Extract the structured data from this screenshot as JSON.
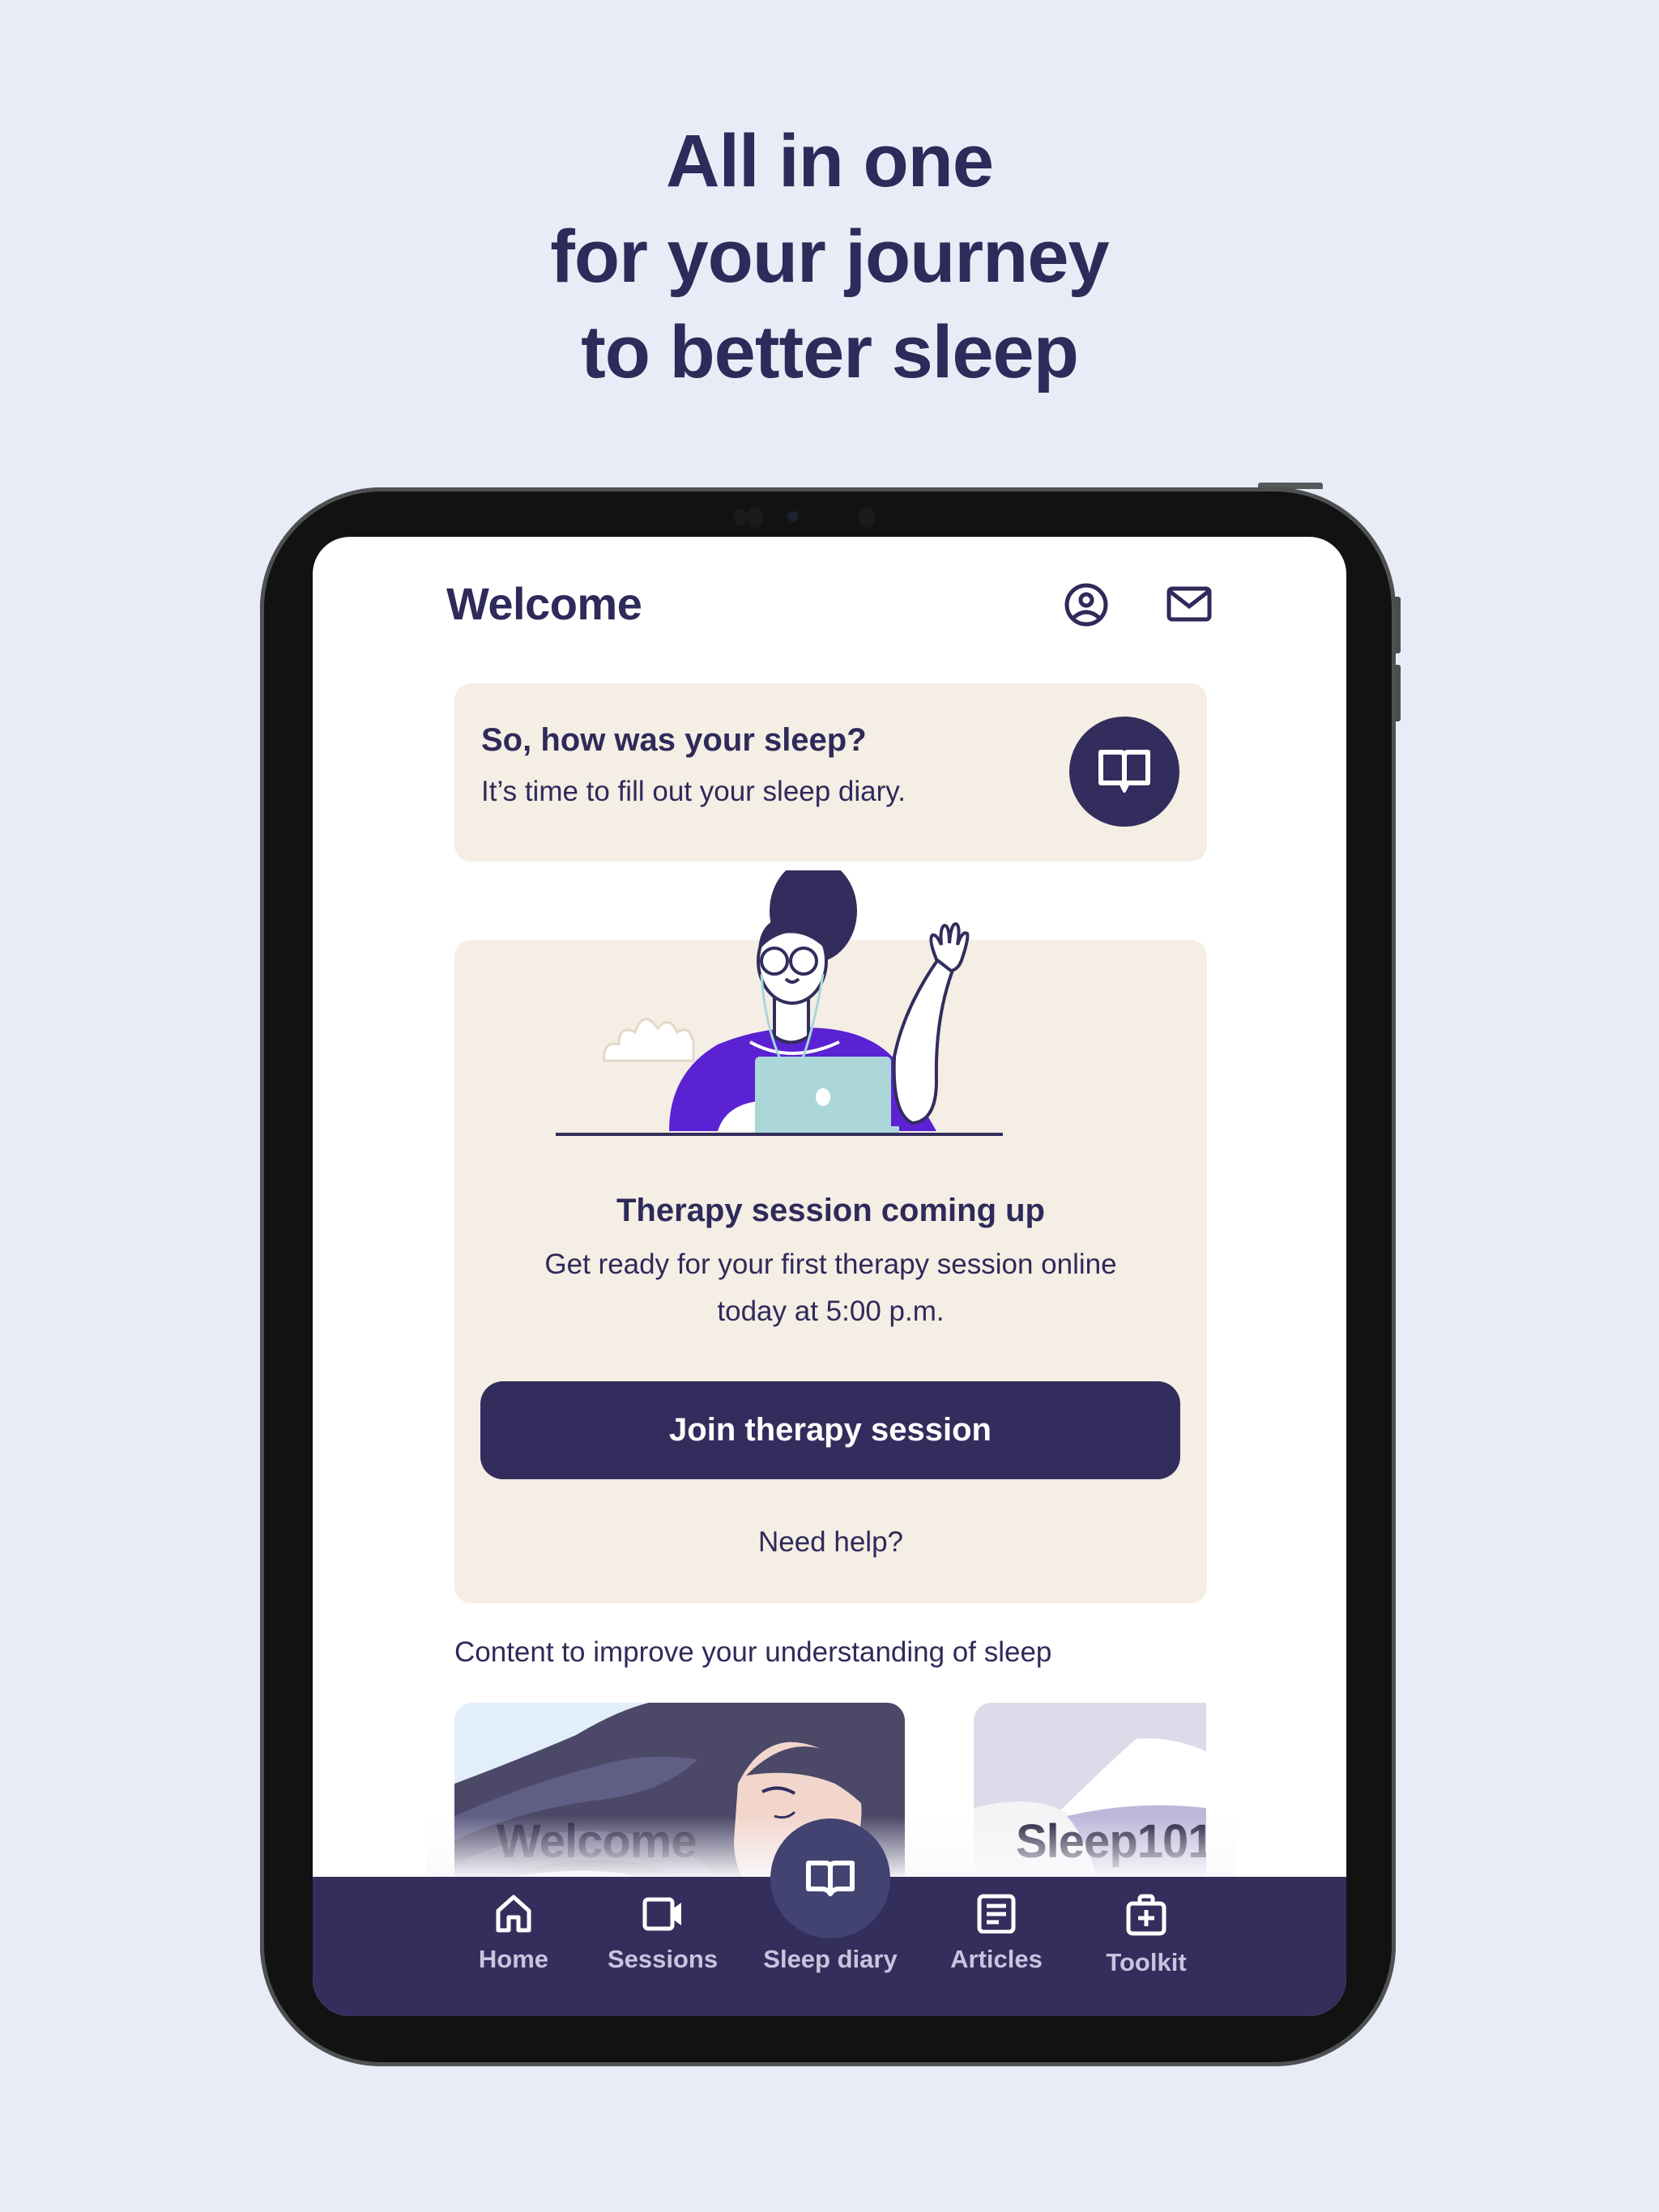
{
  "headline": {
    "lines": [
      "All in one",
      "for your journey",
      "to better sleep"
    ]
  },
  "app": {
    "header": {
      "title": "Welcome",
      "icons": [
        "profile-icon",
        "mail-icon"
      ]
    },
    "sleep_diary_card": {
      "question": "So, how was your sleep?",
      "subtitle": "It’s time to fill out your sleep diary.",
      "icon": "book-open-icon"
    },
    "therapy_card": {
      "title": "Therapy session coming up",
      "description_line1": "Get ready for your first therapy session online",
      "description_line2": "today at 5:00 p.m.",
      "join_button": "Join therapy session",
      "help_link": "Need help?"
    },
    "content_section": {
      "label": "Content to improve your understanding of sleep",
      "cards": [
        {
          "title": "Welcome"
        },
        {
          "title": "Sleep101"
        }
      ]
    },
    "bottom_nav": {
      "items": [
        {
          "label": "Home",
          "icon": "home-icon"
        },
        {
          "label": "Sessions",
          "icon": "video-camera-icon"
        },
        {
          "label": "Sleep diary",
          "icon": "book-open-icon",
          "active_fab": true
        },
        {
          "label": "Articles",
          "icon": "document-icon"
        },
        {
          "label": "Toolkit",
          "icon": "first-aid-kit-icon"
        }
      ]
    }
  },
  "colors": {
    "background": "#e8ecf7",
    "primary": "#332d5d",
    "card": "#f4eee4",
    "nav_bar": "#342e5c",
    "nav_label": "#c9c4de",
    "illustration_purple": "#5a22d2",
    "laptop": "#acd7d9"
  }
}
